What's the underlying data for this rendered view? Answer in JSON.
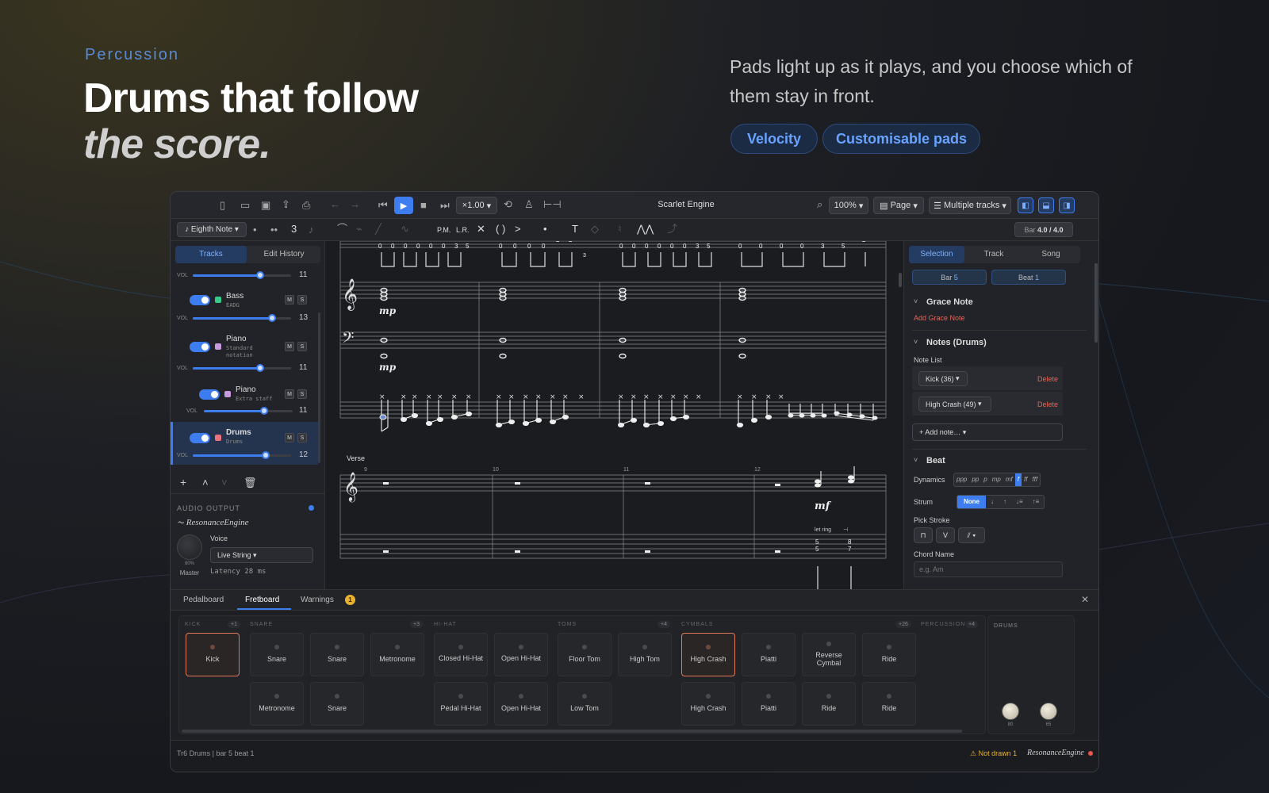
{
  "hero": {
    "eyebrow": "Percussion",
    "title_line1": "Drums that follow",
    "title_line2": "the score.",
    "tagline": "Pads light up as it plays, and you choose which of them stay in front.",
    "pills": [
      "Velocity",
      "Customisable pads"
    ]
  },
  "toolbar": {
    "speed": "×1.00",
    "title": "Scarlet Engine",
    "zoom": "100%",
    "layout": "Page",
    "tracks_view": "Multiple tracks"
  },
  "toolbar2": {
    "duration": "Eighth Note",
    "tuplet": "3",
    "pm": "P.M.",
    "lr": "L.R.",
    "parens": "( )",
    "text_tool": "T",
    "bar_label": "Bar",
    "bar_value": "4.0 / 4.0"
  },
  "left": {
    "tabs": [
      "Tracks",
      "Edit History"
    ],
    "vol_label": "VOL",
    "tracks": [
      {
        "name": "",
        "sub": "",
        "vol": 11,
        "level": 0.69,
        "color": "#3d7df0"
      },
      {
        "name": "Bass",
        "sub": "EADG",
        "vol": 13,
        "level": 0.81,
        "color": "#35c98a"
      },
      {
        "name": "Piano",
        "sub": "Standard",
        "sub2": "notation",
        "vol": 11,
        "level": 0.69,
        "color": "#c69adf"
      },
      {
        "name": "Piano",
        "sub": "Extra staff",
        "vol": 11,
        "level": 0.69,
        "color": "#c69adf"
      },
      {
        "name": "Drums",
        "sub": "Drums",
        "vol": 12,
        "level": 0.75,
        "color": "#e8737d"
      }
    ],
    "ms": [
      "M",
      "S"
    ],
    "audio_output": "AUDIO OUTPUT",
    "engine": "ResonanceEngine",
    "voice_label": "Voice",
    "voice_value": "Live String",
    "knob_value": "80%",
    "knob_label": "Master",
    "latency": "Latency 28 ms"
  },
  "score": {
    "tab_numbers": [
      "0",
      "0",
      "0",
      "0",
      "0",
      "0",
      "3",
      "5",
      "0",
      "0",
      "0",
      "0",
      "2",
      "2",
      "0",
      "0",
      "0",
      "0",
      "0",
      "0",
      "3",
      "5",
      "0",
      "0",
      "0",
      "0",
      "3",
      "5",
      "2"
    ],
    "tab_extra": "3",
    "dyn1": "mp",
    "dyn2": "mp",
    "section": "Verse",
    "bars": [
      "9",
      "10",
      "11",
      "12"
    ],
    "dyn3": "mf",
    "let_ring": "let ring",
    "tab2": [
      "5",
      "5",
      "8",
      "7"
    ]
  },
  "right": {
    "tabs": [
      "Selection",
      "Track",
      "Song"
    ],
    "bar_label": "Bar",
    "bar_value": "5",
    "beat_label": "Beat",
    "beat_value": "1",
    "grace_title": "Grace Note",
    "grace_add": "Add Grace Note",
    "notes_title": "Notes (Drums)",
    "note_list": "Note List",
    "notes": [
      "Kick (36)",
      "High Crash (49)"
    ],
    "delete": "Delete",
    "add_note": "+ Add note…",
    "beat_title": "Beat",
    "dynamics_label": "Dynamics",
    "dynamics": [
      "ppp",
      "pp",
      "p",
      "mp",
      "mf",
      "f",
      "ff",
      "fff"
    ],
    "dynamics_selected": "f",
    "strum_label": "Strum",
    "strum": [
      "None",
      "↓",
      "↑",
      "↓≡",
      "↑≡"
    ],
    "pick_label": "Pick Stroke",
    "chord_label": "Chord Name",
    "chord_placeholder": "e.g. Am"
  },
  "bottom": {
    "tabs": [
      "Pedalboard",
      "Fretboard",
      "Warnings"
    ],
    "warnings_count": "1",
    "groups": [
      {
        "label": "KICK",
        "count": "+1"
      },
      {
        "label": "SNARE",
        "count": "+3"
      },
      {
        "label": "HI-HAT",
        "count": ""
      },
      {
        "label": "TOMS",
        "count": "+4"
      },
      {
        "label": "CYMBALS",
        "count": "+26"
      },
      {
        "label": "PERCUSSION",
        "count": "+4"
      }
    ],
    "pads_row1": [
      "Kick",
      "Snare",
      "Snare",
      "Metronome",
      "Closed Hi-Hat",
      "Open Hi-Hat",
      "Floor Tom",
      "High Tom",
      "High Crash",
      "Piatti",
      "Reverse Cymbal",
      "Ride"
    ],
    "pads_row2": [
      "Metronome",
      "Snare",
      "Pedal Hi-Hat",
      "Open Hi-Hat",
      "Low Tom",
      "High Crash",
      "Piatti",
      "Ride",
      "Ride"
    ],
    "drums_label": "DRUMS",
    "knobs": [
      "80",
      "65"
    ]
  },
  "status": {
    "left": "Tr6 Drums | bar 5 beat 1",
    "warning": "Not drawn 1",
    "engine": "ResonanceEngine"
  }
}
